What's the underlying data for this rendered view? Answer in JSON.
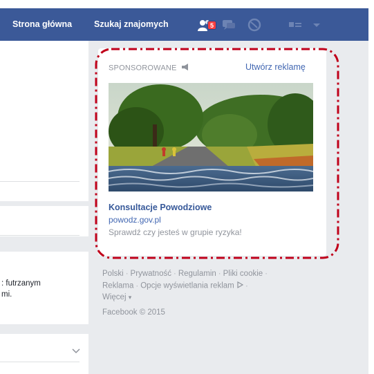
{
  "topbar": {
    "home_label": "Strona główna",
    "find_friends_label": "Szukaj znajomych",
    "friend_requests_count": "5",
    "icons": [
      "friend-requests-icon",
      "messages-icon",
      "notifications-globe-icon",
      "privacy-shortcuts-icon",
      "account-menu-chevron-icon"
    ]
  },
  "ad": {
    "sponsored_label": "SPONSOROWANE",
    "create_ad_label": "Utwórz reklamę",
    "title": "Konsultacje Powodziowe",
    "url": "powodz.gov.pl",
    "description": "Sprawdź czy jesteś w grupie ryzyka!"
  },
  "footer": {
    "line1": [
      "Polski",
      "Prywatność",
      "Regulamin",
      "Pliki cookie"
    ],
    "line2": [
      "Reklama",
      "Opcje wyświetlania reklam"
    ],
    "more_label": "Więcej",
    "copyright": "Facebook © 2015"
  },
  "left_column": {
    "cut_text_line1": ": futrzanym",
    "cut_text_line2": "mi."
  },
  "colors": {
    "topbar": "#3b5998",
    "link": "#4267b2",
    "muted": "#90949c",
    "highlight_outline": "#c0001a"
  }
}
